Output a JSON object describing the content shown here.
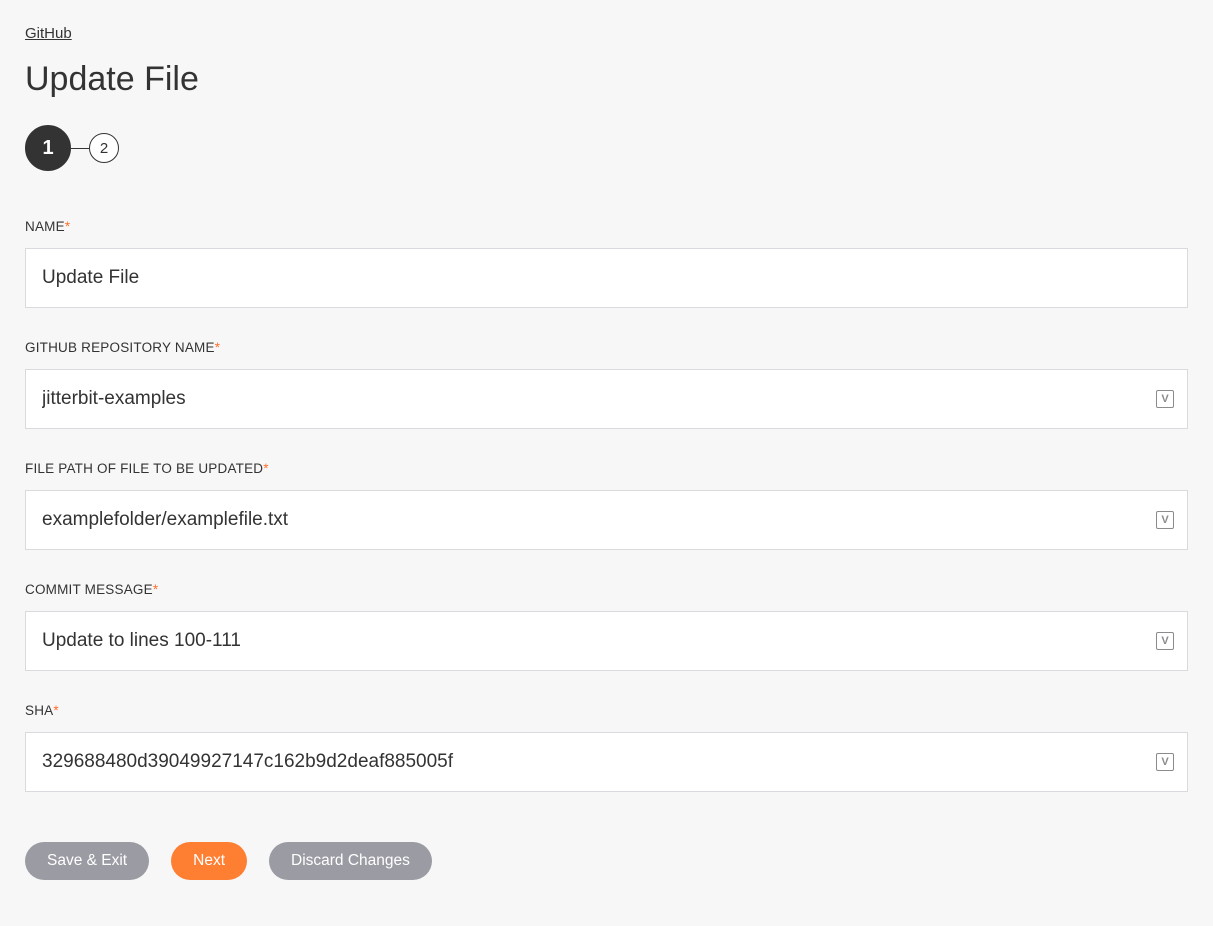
{
  "breadcrumb": "GitHub",
  "title": "Update File",
  "steps": {
    "s1": "1",
    "s2": "2"
  },
  "fields": {
    "name": {
      "label": "NAME",
      "value": "Update File",
      "has_var_icon": false
    },
    "repo": {
      "label": "GITHUB REPOSITORY NAME",
      "value": "jitterbit-examples",
      "has_var_icon": true
    },
    "path": {
      "label": "FILE PATH OF FILE TO BE UPDATED",
      "value": "examplefolder/examplefile.txt",
      "has_var_icon": true
    },
    "commit": {
      "label": "COMMIT MESSAGE",
      "value": "Update to lines 100-111",
      "has_var_icon": true
    },
    "sha": {
      "label": "SHA",
      "value": "329688480d39049927147c162b9d2deaf885005f",
      "has_var_icon": true
    }
  },
  "buttons": {
    "save": "Save & Exit",
    "next": "Next",
    "discard": "Discard Changes"
  }
}
